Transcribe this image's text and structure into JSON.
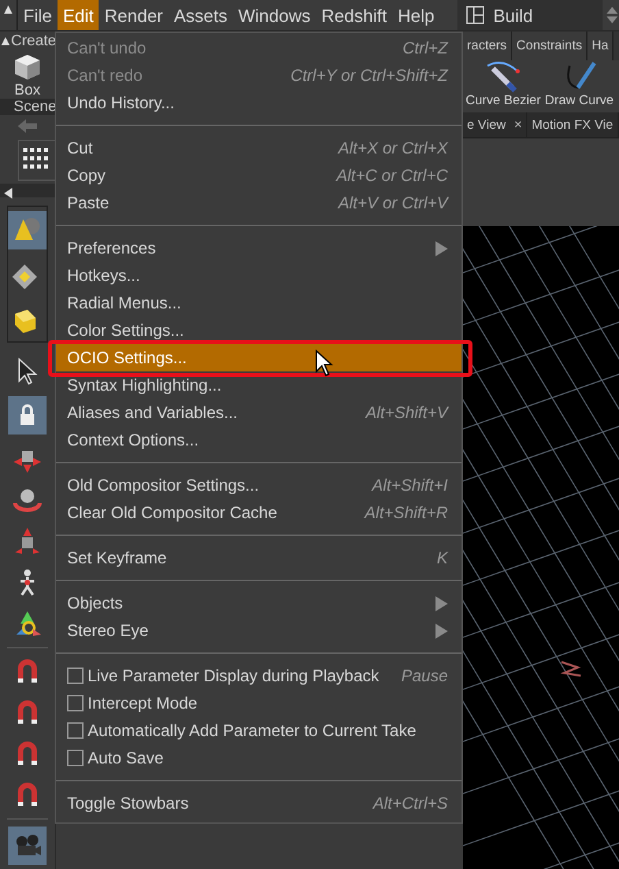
{
  "menubar": {
    "items": [
      {
        "label": "File",
        "selected": false
      },
      {
        "label": "Edit",
        "selected": true
      },
      {
        "label": "Render",
        "selected": false
      },
      {
        "label": "Assets",
        "selected": false
      },
      {
        "label": "Windows",
        "selected": false
      },
      {
        "label": "Redshift",
        "selected": false
      },
      {
        "label": "Help",
        "selected": false
      }
    ],
    "workspace": "Build"
  },
  "shelf": {
    "left_tab": "Create",
    "right_tabs": [
      "racters",
      "Constraints",
      "Ha"
    ],
    "left_tool": "Box",
    "right_tools": [
      "Curve Bezier",
      "Draw Curve"
    ]
  },
  "pane_tabs": {
    "left_tab": "Scene",
    "right_tabs": [
      {
        "label": "e View",
        "close": "×"
      },
      {
        "label": "Motion FX Vie"
      }
    ]
  },
  "edit_menu": {
    "groups": [
      [
        {
          "kind": "command",
          "label": "Can't undo",
          "shortcut": "Ctrl+Z",
          "disabled": true,
          "selected": false
        },
        {
          "kind": "command",
          "label": "Can't redo",
          "shortcut": "Ctrl+Y or Ctrl+Shift+Z",
          "disabled": true,
          "selected": false
        },
        {
          "kind": "command",
          "label": "Undo History...",
          "disabled": false,
          "selected": false
        }
      ],
      [
        {
          "kind": "command",
          "label": "Cut",
          "shortcut": "Alt+X or Ctrl+X",
          "disabled": false,
          "selected": false
        },
        {
          "kind": "command",
          "label": "Copy",
          "shortcut": "Alt+C or Ctrl+C",
          "disabled": false,
          "selected": false
        },
        {
          "kind": "command",
          "label": "Paste",
          "shortcut": "Alt+V or Ctrl+V",
          "disabled": false,
          "selected": false
        }
      ],
      [
        {
          "kind": "submenu",
          "label": "Preferences",
          "selected": false
        },
        {
          "kind": "command",
          "label": "Hotkeys...",
          "disabled": false,
          "selected": false
        },
        {
          "kind": "command",
          "label": "Radial Menus...",
          "disabled": false,
          "selected": false
        },
        {
          "kind": "command",
          "label": "Color Settings...",
          "disabled": false,
          "selected": false
        },
        {
          "kind": "command",
          "label": "OCIO Settings...",
          "disabled": false,
          "selected": true,
          "framed": true
        },
        {
          "kind": "command",
          "label": "Syntax Highlighting...",
          "disabled": false,
          "selected": false
        },
        {
          "kind": "command",
          "label": "Aliases and Variables...",
          "shortcut": "Alt+Shift+V",
          "disabled": false,
          "selected": false
        },
        {
          "kind": "command",
          "label": "Context Options...",
          "disabled": false,
          "selected": false
        }
      ],
      [
        {
          "kind": "command",
          "label": "Old Compositor Settings...",
          "shortcut": "Alt+Shift+I",
          "disabled": false,
          "selected": false
        },
        {
          "kind": "command",
          "label": "Clear Old Compositor Cache",
          "shortcut": "Alt+Shift+R",
          "disabled": false,
          "selected": false
        }
      ],
      [
        {
          "kind": "command",
          "label": "Set Keyframe",
          "shortcut": "K",
          "disabled": false,
          "selected": false
        }
      ],
      [
        {
          "kind": "submenu",
          "label": "Objects",
          "selected": false
        },
        {
          "kind": "submenu",
          "label": "Stereo Eye",
          "selected": false
        }
      ],
      [
        {
          "kind": "toggle",
          "label": "Live Parameter Display during Playback",
          "shortcut": "Pause",
          "checked": false,
          "selected": false
        },
        {
          "kind": "toggle",
          "label": "Intercept Mode",
          "checked": false,
          "selected": false
        },
        {
          "kind": "toggle",
          "label": "Automatically Add Parameter to Current Take",
          "checked": false,
          "selected": false
        },
        {
          "kind": "toggle",
          "label": "Auto Save",
          "checked": false,
          "selected": false
        }
      ],
      [
        {
          "kind": "command",
          "label": "Toggle Stowbars",
          "shortcut": "Alt+Ctrl+S",
          "disabled": false,
          "selected": false
        }
      ]
    ]
  }
}
